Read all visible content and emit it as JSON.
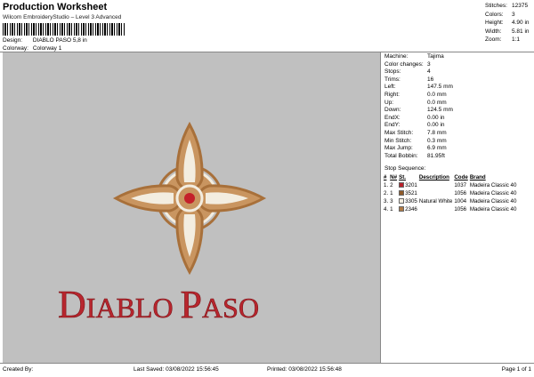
{
  "header": {
    "title": "Production Worksheet",
    "subtitle": "Wilcom EmbroideryStudio – Level 3 Advanced",
    "design_label": "Design:",
    "design_value": "DIABLO PASO 5,8 in",
    "colorway_label": "Colorway:",
    "colorway_value": "Colorway 1"
  },
  "stats": [
    {
      "label": "Stitches:",
      "value": "12375"
    },
    {
      "label": "Colors:",
      "value": "3"
    },
    {
      "label": "Height:",
      "value": "4.90 in"
    },
    {
      "label": "Width:",
      "value": "5.81 in"
    },
    {
      "label": "Zoom:",
      "value": "1:1"
    }
  ],
  "machine_info": [
    {
      "label": "Machine:",
      "value": "Tajima"
    },
    {
      "label": "Color changes:",
      "value": "3"
    },
    {
      "label": "Stops:",
      "value": "4"
    },
    {
      "label": "Trims:",
      "value": "16"
    },
    {
      "label": "Left:",
      "value": "147.5 mm"
    },
    {
      "label": "Right:",
      "value": "0.0 mm"
    },
    {
      "label": "Up:",
      "value": "0.0 mm"
    },
    {
      "label": "Down:",
      "value": "124.5 mm"
    },
    {
      "label": "EndX:",
      "value": "0.00 in"
    },
    {
      "label": "EndY:",
      "value": "0.00 in"
    },
    {
      "label": "Max Stitch:",
      "value": "7.8 mm"
    },
    {
      "label": "Min Stitch:",
      "value": "0.3 mm"
    },
    {
      "label": "Max Jump:",
      "value": "6.9 mm"
    },
    {
      "label": "Total Bobbin:",
      "value": "81.95ft"
    }
  ],
  "stop_sequence": {
    "title": "Stop Sequence:",
    "headers": [
      "#",
      "N#",
      "St.",
      "Description",
      "Code",
      "Brand"
    ],
    "rows": [
      {
        "num": "1.",
        "n": "2",
        "color": "#b8202a",
        "st": "3201",
        "desc": "",
        "code": "1037",
        "brand": "Madeira Classic 40"
      },
      {
        "num": "2.",
        "n": "1",
        "color": "#8f5a2a",
        "st": "3521",
        "desc": "",
        "code": "1056",
        "brand": "Madeira Classic 40"
      },
      {
        "num": "3.",
        "n": "3",
        "color": "#f4efe2",
        "st": "3305",
        "desc": "Natural White",
        "code": "1004",
        "brand": "Madeira Classic 40"
      },
      {
        "num": "4.",
        "n": "1",
        "color": "#b07a44",
        "st": "2346",
        "desc": "",
        "code": "1056",
        "brand": "Madeira Classic 40"
      }
    ]
  },
  "design_art": {
    "text": "Diablo Paso",
    "text_color": "#b8262e",
    "cross_outer": "#a8703a",
    "cross_fill": "#c99560",
    "cross_inner": "#f3ede0",
    "center_dot": "#c4202a",
    "background": "#c0c0c0"
  },
  "footer": {
    "created": "Created By:",
    "last_saved": "Last Saved: 03/08/2022 15:56:45",
    "printed": "Printed: 03/08/2022 15:56:48",
    "page": "Page 1 of 1"
  }
}
